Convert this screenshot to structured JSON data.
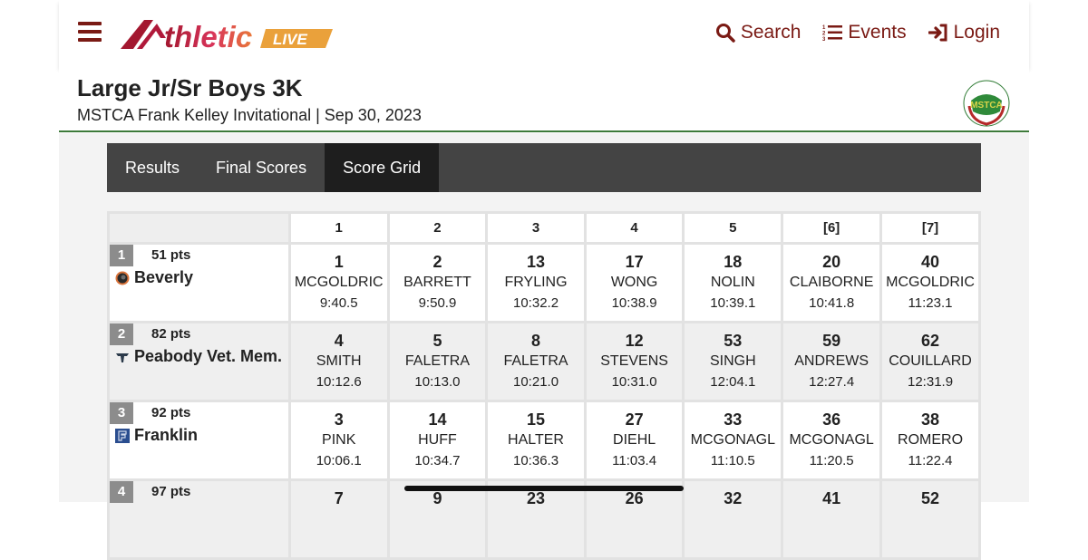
{
  "header": {
    "logo_text": "Athletic",
    "logo_badge": "LIVE",
    "nav": [
      {
        "icon": "search-icon",
        "label": "Search"
      },
      {
        "icon": "ordered-list-icon",
        "label": "Events"
      },
      {
        "icon": "login-icon",
        "label": "Login"
      }
    ]
  },
  "event": {
    "title": "Large Jr/Sr Boys 3K",
    "subtitle": "MSTCA Frank Kelley Invitational | Sep 30, 2023",
    "logo_text": "MSTCA"
  },
  "tabs": [
    {
      "label": "Results",
      "active": false
    },
    {
      "label": "Final Scores",
      "active": false
    },
    {
      "label": "Score Grid",
      "active": true
    }
  ],
  "grid": {
    "columns": [
      "1",
      "2",
      "3",
      "4",
      "5",
      "[6]",
      "[7]"
    ],
    "teams": [
      {
        "place": "1",
        "points": "51 pts",
        "name": "Beverly",
        "icon": "beverly-panther-icon",
        "runners": [
          {
            "place": "1",
            "name": "MCGOLDRIC",
            "time": "9:40.5"
          },
          {
            "place": "2",
            "name": "BARRETT",
            "time": "9:50.9"
          },
          {
            "place": "13",
            "name": "FRYLING",
            "time": "10:32.2"
          },
          {
            "place": "17",
            "name": "WONG",
            "time": "10:38.9"
          },
          {
            "place": "18",
            "name": "NOLIN",
            "time": "10:39.1"
          },
          {
            "place": "20",
            "name": "CLAIBORNE",
            "time": "10:41.8"
          },
          {
            "place": "40",
            "name": "MCGOLDRIC",
            "time": "11:23.1"
          }
        ]
      },
      {
        "place": "2",
        "points": "82 pts",
        "name": "Peabody Vet. Mem.",
        "icon": "peabody-tanner-icon",
        "runners": [
          {
            "place": "4",
            "name": "SMITH",
            "time": "10:12.6"
          },
          {
            "place": "5",
            "name": "FALETRA",
            "time": "10:13.0"
          },
          {
            "place": "8",
            "name": "FALETRA",
            "time": "10:21.0"
          },
          {
            "place": "12",
            "name": "STEVENS",
            "time": "10:31.0"
          },
          {
            "place": "53",
            "name": "SINGH",
            "time": "12:04.1"
          },
          {
            "place": "59",
            "name": "ANDREWS",
            "time": "12:27.4"
          },
          {
            "place": "62",
            "name": "COUILLARD",
            "time": "12:31.9"
          }
        ]
      },
      {
        "place": "3",
        "points": "92 pts",
        "name": "Franklin",
        "icon": "franklin-f-icon",
        "runners": [
          {
            "place": "3",
            "name": "PINK",
            "time": "10:06.1"
          },
          {
            "place": "14",
            "name": "HUFF",
            "time": "10:34.7"
          },
          {
            "place": "15",
            "name": "HALTER",
            "time": "10:36.3"
          },
          {
            "place": "27",
            "name": "DIEHL",
            "time": "11:03.4"
          },
          {
            "place": "33",
            "name": "MCGONAGL",
            "time": "11:10.5"
          },
          {
            "place": "36",
            "name": "MCGONAGL",
            "time": "11:20.5"
          },
          {
            "place": "38",
            "name": "ROMERO",
            "time": "11:22.4"
          }
        ]
      },
      {
        "place": "4",
        "points": "97 pts",
        "name": "",
        "icon": "",
        "runners": [
          {
            "place": "7",
            "name": "",
            "time": ""
          },
          {
            "place": "9",
            "name": "",
            "time": ""
          },
          {
            "place": "23",
            "name": "",
            "time": ""
          },
          {
            "place": "26",
            "name": "",
            "time": ""
          },
          {
            "place": "32",
            "name": "",
            "time": ""
          },
          {
            "place": "41",
            "name": "",
            "time": ""
          },
          {
            "place": "52",
            "name": "",
            "time": ""
          }
        ]
      }
    ]
  },
  "colors": {
    "brand": "#7a1a14",
    "header_rule": "#3d7a3a",
    "tab_bar": "#444444",
    "tab_active": "#1e1e1e"
  }
}
